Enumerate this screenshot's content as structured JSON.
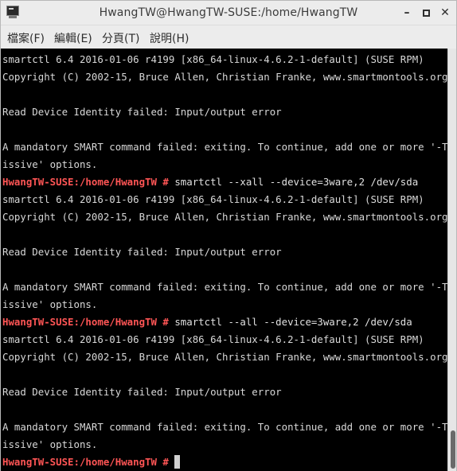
{
  "window": {
    "title": "HwangTW@HwangTW-SUSE:/home/HwangTW",
    "minimize_label": "–",
    "close_label": "✕"
  },
  "menu": {
    "items": [
      "檔案(F)",
      "編輯(E)",
      "分頁(T)",
      "說明(H)"
    ]
  },
  "terminal": {
    "lines": [
      {
        "text": "smartctl 6.4 2016-01-06 r4199 [x86_64-linux-4.6.2-1-default] (SUSE RPM)"
      },
      {
        "text": "Copyright (C) 2002-15, Bruce Allen, Christian Franke, www.smartmontools.org"
      },
      {
        "text": ""
      },
      {
        "text": "Read Device Identity failed: Input/output error"
      },
      {
        "text": ""
      },
      {
        "text": "A mandatory SMART command failed: exiting. To continue, add one or more '-T perm"
      },
      {
        "text": "issive' options."
      },
      {
        "prompt": "HwangTW-SUSE:/home/HwangTW #",
        "command": " smartctl --xall --device=3ware,2 /dev/sda"
      },
      {
        "text": "smartctl 6.4 2016-01-06 r4199 [x86_64-linux-4.6.2-1-default] (SUSE RPM)"
      },
      {
        "text": "Copyright (C) 2002-15, Bruce Allen, Christian Franke, www.smartmontools.org"
      },
      {
        "text": ""
      },
      {
        "text": "Read Device Identity failed: Input/output error"
      },
      {
        "text": ""
      },
      {
        "text": "A mandatory SMART command failed: exiting. To continue, add one or more '-T perm"
      },
      {
        "text": "issive' options."
      },
      {
        "prompt": "HwangTW-SUSE:/home/HwangTW #",
        "command": " smartctl --all --device=3ware,2 /dev/sda"
      },
      {
        "text": "smartctl 6.4 2016-01-06 r4199 [x86_64-linux-4.6.2-1-default] (SUSE RPM)"
      },
      {
        "text": "Copyright (C) 2002-15, Bruce Allen, Christian Franke, www.smartmontools.org"
      },
      {
        "text": ""
      },
      {
        "text": "Read Device Identity failed: Input/output error"
      },
      {
        "text": ""
      },
      {
        "text": "A mandatory SMART command failed: exiting. To continue, add one or more '-T perm"
      },
      {
        "text": "issive' options."
      },
      {
        "prompt": "HwangTW-SUSE:/home/HwangTW #",
        "command": " ",
        "cursor": true
      }
    ]
  },
  "colors": {
    "prompt": "#ff5555",
    "output": "#d8d8d8",
    "background": "#000000"
  }
}
